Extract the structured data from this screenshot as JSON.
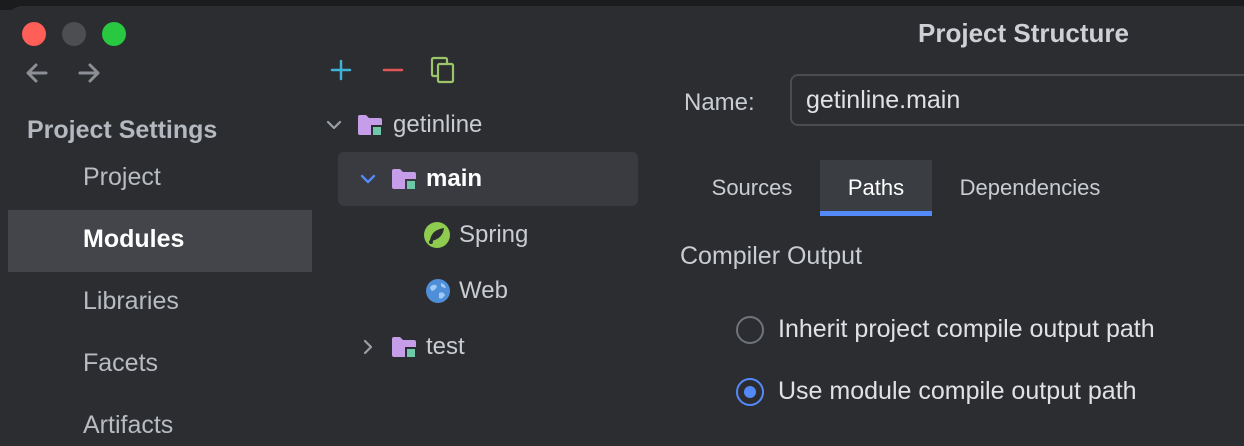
{
  "window": {
    "title": "Project Structure"
  },
  "sidebar": {
    "header": "Project Settings",
    "items": [
      {
        "label": "Project",
        "selected": false
      },
      {
        "label": "Modules",
        "selected": true
      },
      {
        "label": "Libraries",
        "selected": false
      },
      {
        "label": "Facets",
        "selected": false
      },
      {
        "label": "Artifacts",
        "selected": false
      }
    ]
  },
  "toolbar": {
    "add_icon": "plus-icon",
    "remove_icon": "minus-icon",
    "copy_icon": "copy-icon"
  },
  "tree": {
    "root": {
      "label": "getinline",
      "expanded": true,
      "icon": "module-folder-icon"
    },
    "main": {
      "label": "main",
      "expanded": true,
      "selected": true,
      "icon": "module-folder-icon"
    },
    "spring": {
      "label": "Spring",
      "icon": "spring-icon"
    },
    "web": {
      "label": "Web",
      "icon": "globe-icon"
    },
    "test": {
      "label": "test",
      "expanded": false,
      "icon": "module-folder-icon"
    }
  },
  "details": {
    "name_label": "Name:",
    "name_value": "getinline.main",
    "tabs": [
      {
        "label": "Sources",
        "active": false
      },
      {
        "label": "Paths",
        "active": true
      },
      {
        "label": "Dependencies",
        "active": false
      }
    ],
    "section_title": "Compiler Output",
    "options": [
      {
        "label": "Inherit project compile output path",
        "checked": false
      },
      {
        "label": "Use module compile output path",
        "checked": true
      }
    ]
  },
  "colors": {
    "accent": "#548af7",
    "background": "#2b2d30",
    "selection": "#43454a",
    "folder": "#c59de8"
  }
}
